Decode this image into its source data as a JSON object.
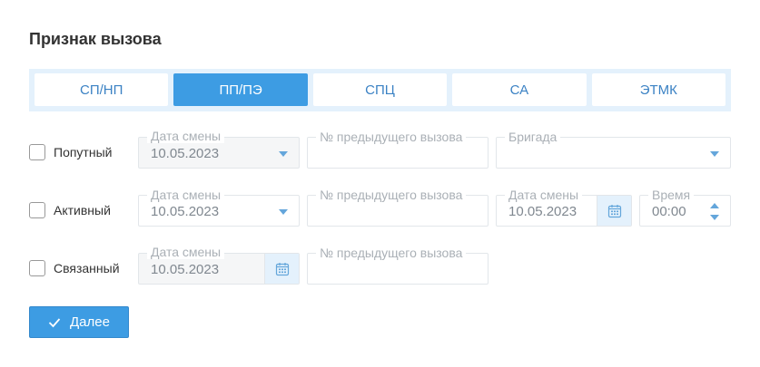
{
  "title": "Признак вызова",
  "tabs": [
    {
      "label": "СП/НП",
      "active": false
    },
    {
      "label": "ПП/ПЭ",
      "active": true
    },
    {
      "label": "СПЦ",
      "active": false
    },
    {
      "label": "СА",
      "active": false
    },
    {
      "label": "ЭТМК",
      "active": false
    }
  ],
  "rows": [
    {
      "checkbox_label": "Попутный",
      "shift_date_label": "Дата смены",
      "shift_date_value": "10.05.2023",
      "prev_call_label": "№ предыдущего вызова",
      "prev_call_value": "",
      "brigade_label": "Бригада",
      "brigade_value": ""
    },
    {
      "checkbox_label": "Активный",
      "shift_date_label": "Дата смены",
      "shift_date_value": "10.05.2023",
      "prev_call_label": "№ предыдущего вызова",
      "prev_call_value": "",
      "date_label": "Дата смены",
      "date_value": "10.05.2023",
      "time_label": "Время",
      "time_value": "00:00"
    },
    {
      "checkbox_label": "Связанный",
      "shift_date_label": "Дата смены",
      "shift_date_value": "10.05.2023",
      "prev_call_label": "№ предыдущего вызова",
      "prev_call_value": ""
    }
  ],
  "next_button": {
    "label": "Далее",
    "icon": "check-icon"
  },
  "colors": {
    "accent": "#3d9ce3",
    "tab_bg": "#e4f1fc",
    "tab_text": "#3b82c4"
  }
}
